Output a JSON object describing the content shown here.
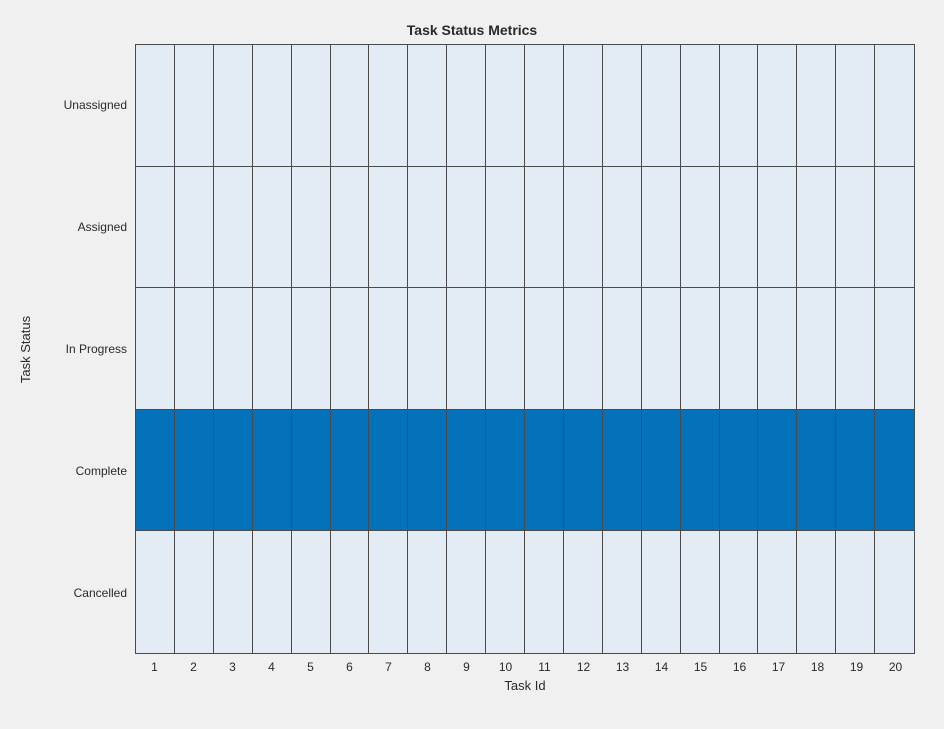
{
  "chart_data": {
    "type": "heatmap",
    "title": "Task Status Metrics",
    "xlabel": "Task Id",
    "ylabel": "Task Status",
    "x_categories": [
      "1",
      "2",
      "3",
      "4",
      "5",
      "6",
      "7",
      "8",
      "9",
      "10",
      "11",
      "12",
      "13",
      "14",
      "15",
      "16",
      "17",
      "18",
      "19",
      "20"
    ],
    "y_categories": [
      "Unassigned",
      "Assigned",
      "In Progress",
      "Complete",
      "Cancelled"
    ],
    "values": [
      [
        0,
        0,
        0,
        0,
        0,
        0,
        0,
        0,
        0,
        0,
        0,
        0,
        0,
        0,
        0,
        0,
        0,
        0,
        0,
        0
      ],
      [
        0,
        0,
        0,
        0,
        0,
        0,
        0,
        0,
        0,
        0,
        0,
        0,
        0,
        0,
        0,
        0,
        0,
        0,
        0,
        0
      ],
      [
        0,
        0,
        0,
        0,
        0,
        0,
        0,
        0,
        0,
        0,
        0,
        0,
        0,
        0,
        0,
        0,
        0,
        0,
        0,
        0
      ],
      [
        1,
        1,
        1,
        1,
        1,
        1,
        1,
        1,
        1,
        1,
        1,
        1,
        1,
        1,
        1,
        1,
        1,
        1,
        1,
        1
      ],
      [
        0,
        0,
        0,
        0,
        0,
        0,
        0,
        0,
        0,
        0,
        0,
        0,
        0,
        0,
        0,
        0,
        0,
        0,
        0,
        0
      ]
    ],
    "colormap": {
      "low": "#e3ecf4",
      "high": "#0472bb"
    }
  }
}
